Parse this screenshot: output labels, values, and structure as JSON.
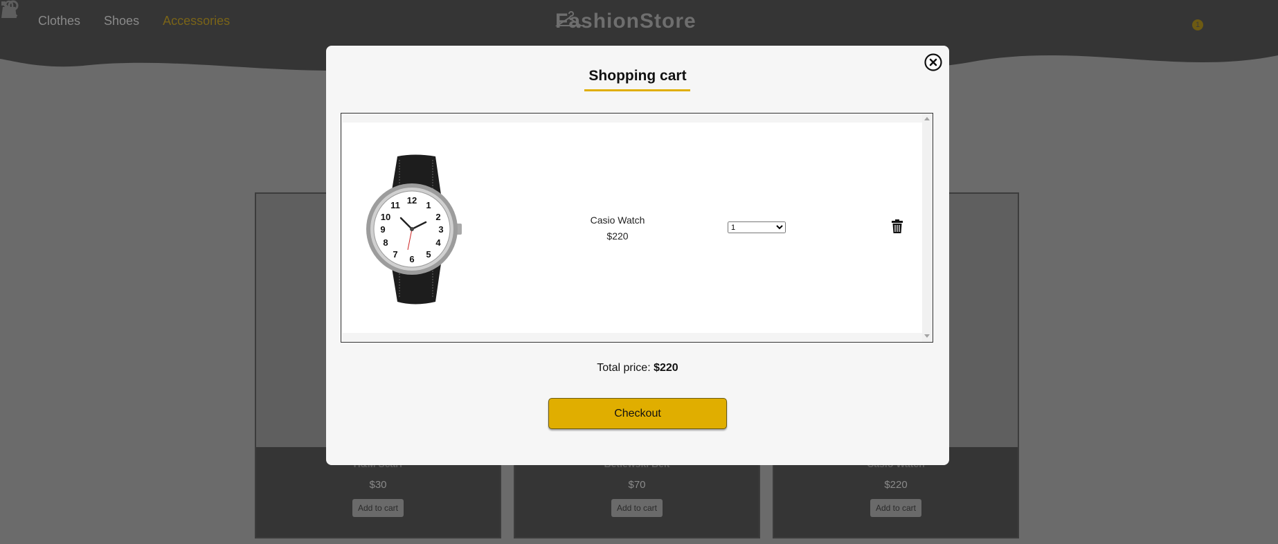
{
  "nav": {
    "items": [
      {
        "label": "Clothes"
      },
      {
        "label": "Shoes"
      },
      {
        "label": "Accessories"
      }
    ],
    "active": "Accessories"
  },
  "brand": {
    "name": "FashionStore"
  },
  "header": {
    "cart_count": "1"
  },
  "products": [
    {
      "name": "H&M Scarf",
      "price": "$30",
      "button": "Add to cart"
    },
    {
      "name": "Betlewski Belt",
      "price": "$70",
      "button": "Add to cart"
    },
    {
      "name": "Casio Watch",
      "price": "$220",
      "button": "Add to cart"
    }
  ],
  "modal": {
    "title": "Shopping cart",
    "items": [
      {
        "name": "Casio Watch",
        "price": "$220",
        "quantity": "1"
      }
    ],
    "total_label": "Total price:",
    "total_value": "$220",
    "checkout_label": "Checkout"
  },
  "colors": {
    "accent": "#e0ae00",
    "modal_bg": "#f6f6f6",
    "overlay": "#6b6b6b",
    "header_bg": "#353535"
  }
}
